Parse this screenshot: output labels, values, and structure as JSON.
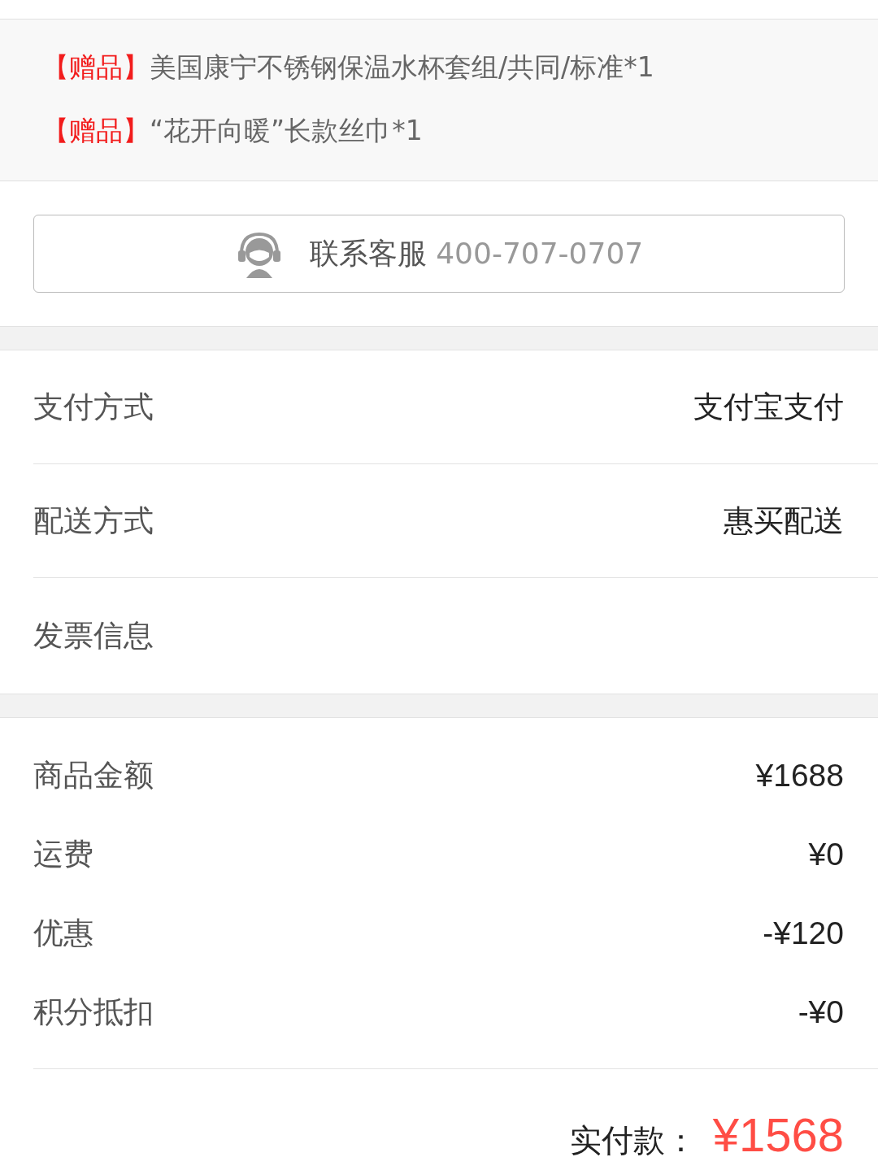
{
  "gifts": [
    {
      "tag": "【赠品】",
      "name": "美国康宁不锈钢保温水杯套组/共同/标准*1"
    },
    {
      "tag": "【赠品】",
      "name": "“花开向暖”长款丝巾*1"
    }
  ],
  "service_button": {
    "label": "联系客服",
    "phone": "400-707-0707"
  },
  "order_info": [
    {
      "label": "支付方式",
      "value": "支付宝支付"
    },
    {
      "label": "配送方式",
      "value": "惠买配送"
    },
    {
      "label": "发票信息"
    }
  ],
  "summary": [
    {
      "label": "商品金额",
      "value": "¥1688"
    },
    {
      "label": "运费",
      "value": "¥0"
    },
    {
      "label": "优惠",
      "value": "-¥120"
    },
    {
      "label": "积分抵扣",
      "value": "-¥0"
    }
  ],
  "total": {
    "label": "实付款：",
    "amount": "¥1568"
  }
}
